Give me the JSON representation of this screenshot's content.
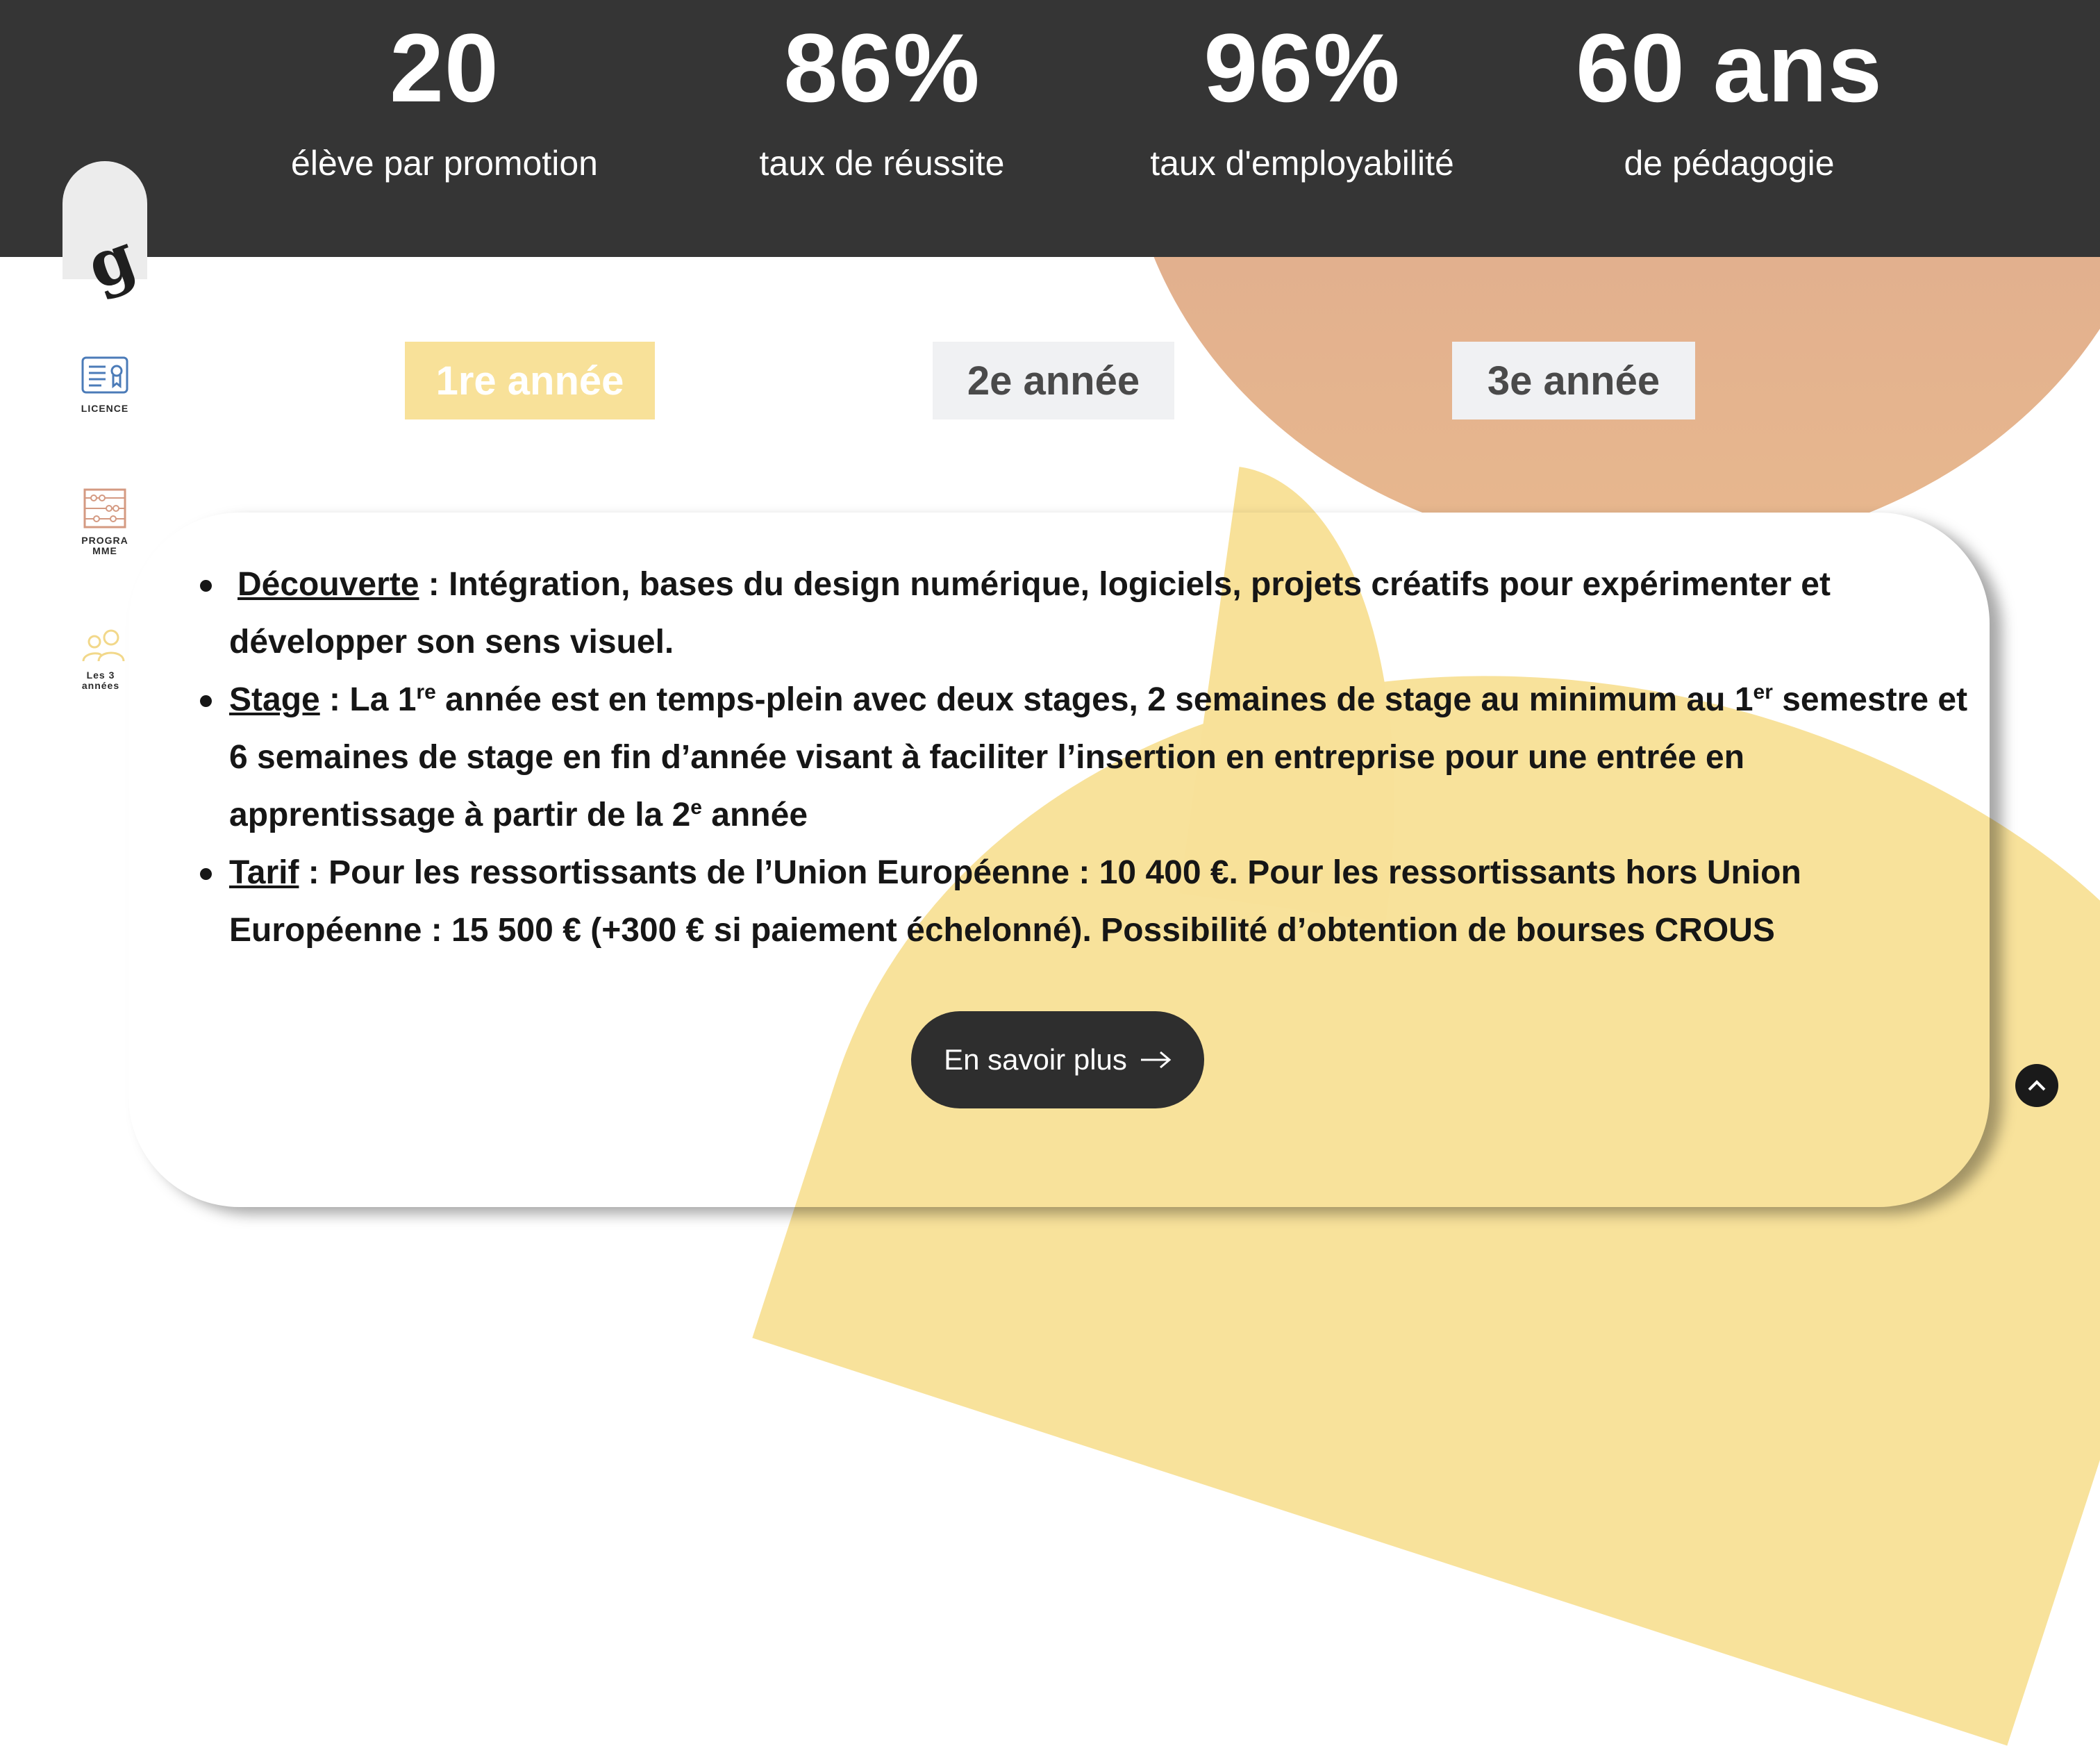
{
  "stats": [
    {
      "value": "20",
      "label": "élève par promotion"
    },
    {
      "value": "86%",
      "label": "taux de réussite"
    },
    {
      "value": "96%",
      "label": "taux d'employabilité"
    },
    {
      "value": "60 ans",
      "label": "de pédagogie"
    }
  ],
  "sidebar": {
    "logo": "g",
    "items": [
      {
        "label": "LICENCE",
        "icon": "certificate-icon"
      },
      {
        "label": "PROGRA MME",
        "icon": "abacus-icon"
      },
      {
        "label": "Les 3 années",
        "icon": "users-icon"
      }
    ]
  },
  "tabs": [
    {
      "label": "1re année",
      "active": true
    },
    {
      "label": "2e année",
      "active": false
    },
    {
      "label": "3e année",
      "active": false
    }
  ],
  "features": {
    "f1": {
      "term": "Découverte",
      "text": " : Intégration, bases du design numérique, logiciels, projets créatifs pour expérimenter et développer son sens visuel."
    },
    "f2": {
      "term": "Stage",
      "t1": " : La 1",
      "sup1": "re",
      "t2": " année  est en temps-plein avec deux stages, 2 semaines de stage au minimum au 1",
      "sup2": "er",
      "t3": " semestre et 6 semaines de stage en fin d’année visant à faciliter l’insertion en entreprise pour une entrée en apprentissage à partir de la 2",
      "sup3": "e",
      "t4": " année"
    },
    "f3": {
      "term": "Tarif",
      "text": " : Pour les ressortissants de  l’Union Européenne : 10 400 €. Pour les ressortissants hors Union Européenne : 15 500 € (+300 € si paiement échelonné).  Possibilité d’obtention de bourses CROUS"
    }
  },
  "cta": {
    "label": "En savoir plus"
  },
  "colors": {
    "dark": "#353535",
    "yellow": "#f8e199",
    "peach": "#e0ad8f"
  }
}
